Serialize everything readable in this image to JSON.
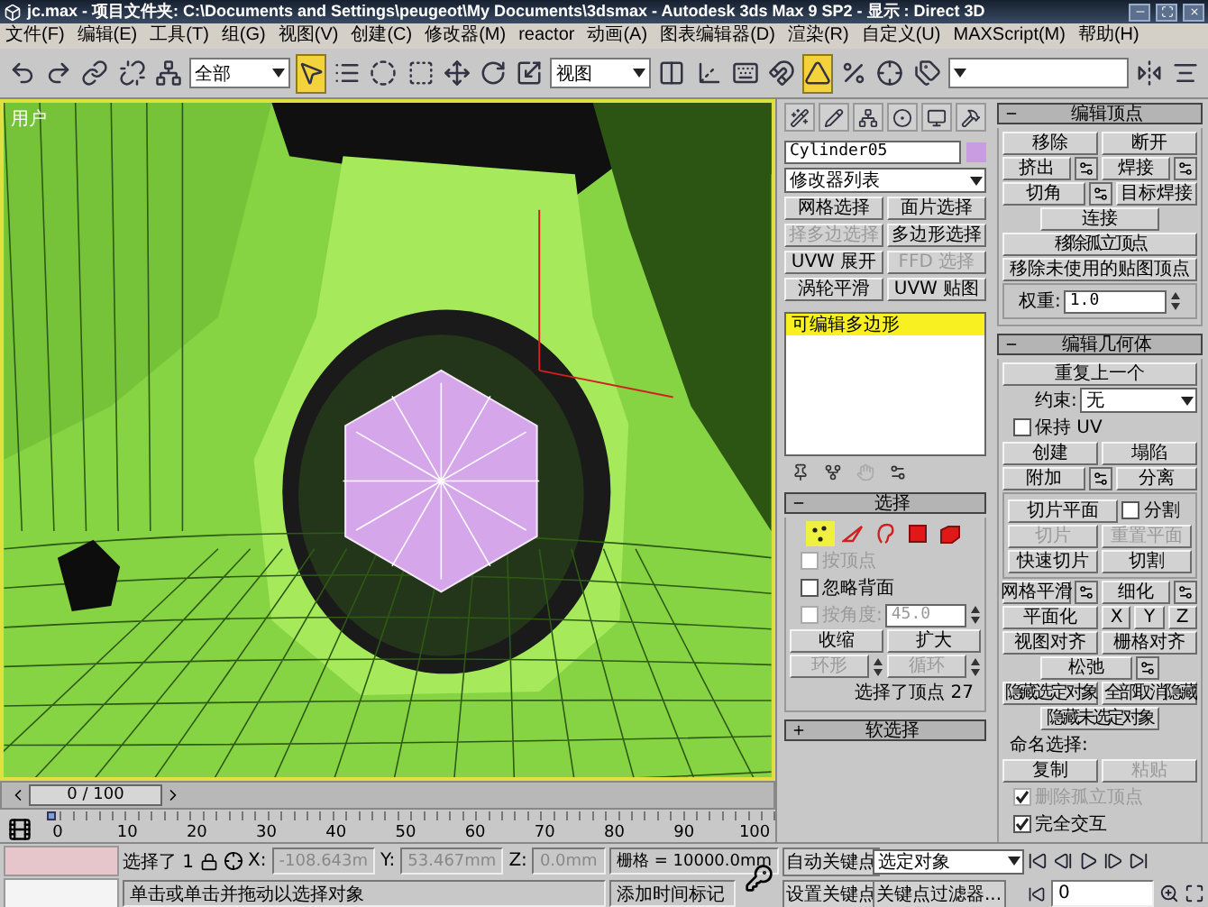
{
  "window": {
    "title": "jc.max   - 项目文件夹: C:\\Documents and Settings\\peugeot\\My Documents\\3dsmax    - Autodesk 3ds Max 9 SP2    - 显示 : Direct 3D"
  },
  "menu": [
    "文件(F)",
    "编辑(E)",
    "工具(T)",
    "组(G)",
    "视图(V)",
    "创建(C)",
    "修改器(M)",
    "reactor",
    "动画(A)",
    "图表编辑器(D)",
    "渲染(R)",
    "自定义(U)",
    "MAXScript(M)",
    "帮助(H)"
  ],
  "toolbar": [
    {
      "kind": "undo",
      "selected": false
    },
    {
      "kind": "redo",
      "selected": false
    },
    {
      "kind": "link",
      "selected": false
    },
    {
      "kind": "unlink",
      "selected": false
    },
    {
      "kind": "bind",
      "selected": false
    },
    {
      "kind": "dropdown",
      "value": "全部"
    },
    {
      "kind": "select",
      "selected": true
    },
    {
      "kind": "select-by-name",
      "selected": false
    },
    {
      "kind": "circle-region",
      "selected": false
    },
    {
      "kind": "window",
      "selected": false
    },
    {
      "kind": "move",
      "selected": false
    },
    {
      "kind": "rotate",
      "selected": false
    },
    {
      "kind": "scale",
      "selected": false
    },
    {
      "kind": "dropdown",
      "value": "视图"
    },
    {
      "kind": "pivot",
      "selected": false
    },
    {
      "kind": "manipulate",
      "selected": false
    },
    {
      "kind": "keyboard",
      "selected": false
    },
    {
      "kind": "snap",
      "selected": false
    },
    {
      "kind": "angle-snap",
      "selected": true
    },
    {
      "kind": "percent-snap",
      "selected": false
    },
    {
      "kind": "spinner-snap",
      "selected": false
    },
    {
      "kind": "named-sets",
      "selected": false
    },
    {
      "kind": "dropdown"
    },
    {
      "kind": "mirror",
      "selected": false
    },
    {
      "kind": "align",
      "selected": false
    }
  ],
  "viewport": {
    "label": "用户"
  },
  "time_slider": {
    "label": "0 / 100"
  },
  "ruler": {
    "labels": [
      "0",
      "10",
      "20",
      "30",
      "40",
      "50",
      "60",
      "70",
      "80",
      "90",
      "100"
    ]
  },
  "command_panel": {
    "object_name": "Cylinder05",
    "modifier_list": "修改器列表",
    "modifier_buttons": [
      {
        "label": "网格选择",
        "disabled": false
      },
      {
        "label": "面片选择",
        "disabled": false
      },
      {
        "label": "择多边选择",
        "disabled": true
      },
      {
        "label": "多边形选择",
        "disabled": false
      },
      {
        "label": "UVW 展开",
        "disabled": false
      },
      {
        "label": "FFD 选择",
        "disabled": true
      },
      {
        "label": "涡轮平滑",
        "disabled": false
      },
      {
        "label": "UVW 贴图",
        "disabled": false
      }
    ],
    "stack": [
      {
        "label": "可编辑多边形",
        "selected": true
      }
    ],
    "left_rollouts": [
      {
        "title": "选择",
        "expanded": true,
        "rows": [
          {
            "kind": "levels",
            "items": [
              {
                "kind": "vertex",
                "selected": true
              },
              {
                "kind": "edge",
                "selected": false
              },
              {
                "kind": "border",
                "selected": false
              },
              {
                "kind": "polygon",
                "selected": false
              },
              {
                "kind": "element",
                "selected": false
              }
            ]
          },
          {
            "kind": "checkbox",
            "label": "按顶点",
            "checked": false,
            "disabled": true
          },
          {
            "kind": "checkbox",
            "label": "忽略背面",
            "checked": false,
            "disabled": false
          },
          {
            "kind": "checkspinner",
            "label": "按角度:",
            "value": "45.0",
            "checked": false,
            "disabled": true
          },
          {
            "kind": "buttons",
            "items": [
              {
                "label": "收缩",
                "disabled": false,
                "kind": "plain"
              },
              {
                "label": "扩大",
                "disabled": false,
                "kind": "plain"
              }
            ]
          },
          {
            "kind": "buttons",
            "items": [
              {
                "label": "环形",
                "disabled": true,
                "kind": "spinner"
              },
              {
                "label": "循环",
                "disabled": true,
                "kind": "spinner"
              }
            ]
          },
          {
            "kind": "text",
            "text": "选择了顶点 27"
          }
        ]
      },
      {
        "title": "软选择",
        "expanded": false
      }
    ],
    "right_rollouts": [
      {
        "title": "编辑顶点",
        "expanded": true,
        "rows": [
          {
            "kind": "buttons",
            "items": [
              {
                "label": "移除",
                "disabled": false,
                "kind": "plain"
              },
              {
                "label": "断开",
                "disabled": false,
                "kind": "plain"
              }
            ]
          },
          {
            "kind": "buttons",
            "items": [
              {
                "label": "挤出",
                "disabled": false,
                "kind": "settings"
              },
              {
                "label": "焊接",
                "disabled": false,
                "kind": "settings"
              }
            ]
          },
          {
            "kind": "buttons",
            "items": [
              {
                "label": "切角",
                "disabled": false,
                "kind": "settings"
              },
              {
                "label": "目标焊接",
                "disabled": false,
                "kind": "plain"
              }
            ]
          },
          {
            "kind": "center",
            "items": [
              {
                "label": "连接",
                "disabled": false,
                "kind": "plain"
              }
            ]
          },
          {
            "kind": "buttons",
            "items": [
              {
                "label": "移除孤立顶点",
                "disabled": false,
                "kind": "plain"
              }
            ]
          },
          {
            "kind": "buttons",
            "items": [
              {
                "label": "移除未使用的贴图顶点",
                "disabled": false,
                "kind": "plain"
              }
            ]
          },
          {
            "kind": "group",
            "rows": [
              {
                "kind": "spinner",
                "label": "权重:",
                "value": "1.0",
                "disabled": false
              }
            ]
          }
        ]
      },
      {
        "title": "编辑几何体",
        "expanded": true,
        "rows": [
          {
            "kind": "buttons",
            "items": [
              {
                "label": "重复上一个",
                "disabled": false,
                "kind": "plain"
              }
            ]
          },
          {
            "kind": "dropdown",
            "label": "约束:",
            "value": "无"
          },
          {
            "kind": "checkbox",
            "label": "保持 UV",
            "checked": false,
            "disabled": false
          },
          {
            "kind": "buttons",
            "items": [
              {
                "label": "创建",
                "disabled": false,
                "kind": "plain"
              },
              {
                "label": "塌陷",
                "disabled": false,
                "kind": "plain"
              }
            ]
          },
          {
            "kind": "buttons",
            "items": [
              {
                "label": "附加",
                "disabled": false,
                "kind": "settings"
              },
              {
                "label": "分离",
                "disabled": false,
                "kind": "plain"
              }
            ]
          },
          {
            "kind": "group",
            "rows": [
              {
                "kind": "buttoncheck",
                "label": "切片平面",
                "disabled": false,
                "check_label": "分割",
                "checked": false
              },
              {
                "kind": "buttons",
                "items": [
                  {
                    "label": "切片",
                    "disabled": true,
                    "kind": "plain"
                  },
                  {
                    "label": "重置平面",
                    "disabled": true,
                    "kind": "plain"
                  }
                ]
              },
              {
                "kind": "buttons",
                "items": [
                  {
                    "label": "快速切片",
                    "disabled": false,
                    "kind": "plain"
                  },
                  {
                    "label": "切割",
                    "disabled": false,
                    "kind": "plain"
                  }
                ]
              }
            ]
          },
          {
            "kind": "buttons",
            "items": [
              {
                "label": "网格平滑",
                "disabled": false,
                "kind": "settings"
              },
              {
                "label": "细化",
                "disabled": false,
                "kind": "settings"
              }
            ]
          },
          {
            "kind": "buttons",
            "items": [
              {
                "label": "平面化",
                "disabled": false,
                "kind": "plain"
              },
              {
                "label": "X",
                "disabled": false,
                "kind": "plain"
              },
              {
                "label": "Y",
                "disabled": false,
                "kind": "plain"
              },
              {
                "label": "Z",
                "disabled": false,
                "kind": "plain"
              }
            ]
          },
          {
            "kind": "buttons",
            "items": [
              {
                "label": "视图对齐",
                "disabled": false,
                "kind": "plain"
              },
              {
                "label": "栅格对齐",
                "disabled": false,
                "kind": "plain"
              }
            ]
          },
          {
            "kind": "center",
            "items": [
              {
                "label": "松弛",
                "disabled": false,
                "kind": "settings"
              }
            ]
          },
          {
            "kind": "buttons",
            "items": [
              {
                "label": "隐藏选定对象",
                "disabled": false,
                "kind": "plain"
              },
              {
                "label": "全部取消隐藏",
                "disabled": false,
                "kind": "plain"
              }
            ]
          },
          {
            "kind": "center",
            "items": [
              {
                "label": "隐藏未选定对象",
                "disabled": false,
                "kind": "plain"
              }
            ]
          },
          {
            "kind": "text",
            "text": "命名选择:"
          },
          {
            "kind": "buttons",
            "items": [
              {
                "label": "复制",
                "disabled": false,
                "kind": "plain"
              },
              {
                "label": "粘贴",
                "disabled": true,
                "kind": "plain"
              }
            ]
          },
          {
            "kind": "checkbox",
            "label": "删除孤立顶点",
            "checked": true,
            "disabled": true
          },
          {
            "kind": "checkbox",
            "label": "完全交互",
            "checked": true,
            "disabled": false
          }
        ]
      }
    ]
  },
  "status_bar": {
    "selection": "选择了 1",
    "x_label": "X:",
    "x": "-108.643m",
    "y_label": "Y:",
    "y": "53.467mm",
    "z_label": "Z:",
    "z": "0.0mm",
    "grid": "栅格 = 10000.0mm",
    "auto_key": "自动关键点",
    "key_mode": "选定对象",
    "prompt": "单击或单击并拖动以选择对象",
    "time_tag": "添加时间标记",
    "set_key": "设置关键点",
    "key_filters": "关键点过滤器...",
    "frame": "0"
  }
}
